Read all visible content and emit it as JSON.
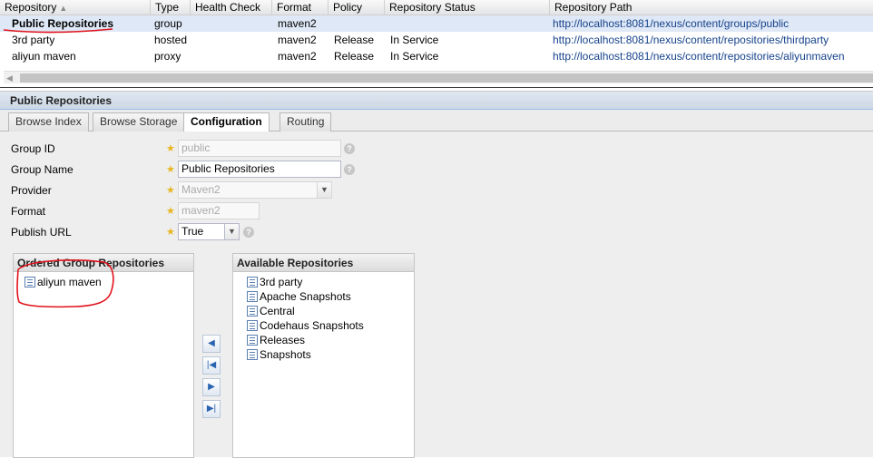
{
  "grid": {
    "columns": [
      "Repository",
      "Type",
      "Health Check",
      "Format",
      "Policy",
      "Repository Status",
      "Repository Path"
    ],
    "sort_indicator": "▲",
    "rows": [
      {
        "name": "Public Repositories",
        "type": "group",
        "health": "",
        "format": "maven2",
        "policy": "",
        "status": "",
        "path": "http://localhost:8081/nexus/content/groups/public"
      },
      {
        "name": "3rd party",
        "type": "hosted",
        "health": "",
        "format": "maven2",
        "policy": "Release",
        "status": "In Service",
        "path": "http://localhost:8081/nexus/content/repositories/thirdparty"
      },
      {
        "name": "aliyun maven",
        "type": "proxy",
        "health": "",
        "format": "maven2",
        "policy": "Release",
        "status": "In Service",
        "path": "http://localhost:8081/nexus/content/repositories/aliyunmaven"
      }
    ]
  },
  "panel": {
    "title": "Public Repositories",
    "tabs": [
      "Browse Index",
      "Browse Storage",
      "Configuration",
      "Routing"
    ],
    "active_tab": "Configuration"
  },
  "form": {
    "group_id_label": "Group ID",
    "group_id_value": "public",
    "group_name_label": "Group Name",
    "group_name_value": "Public Repositories",
    "provider_label": "Provider",
    "provider_value": "Maven2",
    "format_label": "Format",
    "format_value": "maven2",
    "publish_url_label": "Publish URL",
    "publish_url_value": "True",
    "required_mark": "★",
    "help_mark": "?"
  },
  "ordered": {
    "title": "Ordered Group Repositories",
    "items": [
      "aliyun maven"
    ]
  },
  "available": {
    "title": "Available Repositories",
    "items": [
      "3rd party",
      "Apache Snapshots",
      "Central",
      "Codehaus Snapshots",
      "Releases",
      "Snapshots"
    ]
  },
  "colors": {
    "selected_row": "#dfe8f6",
    "link": "#15428b",
    "annotation_red": "#e0121b"
  }
}
